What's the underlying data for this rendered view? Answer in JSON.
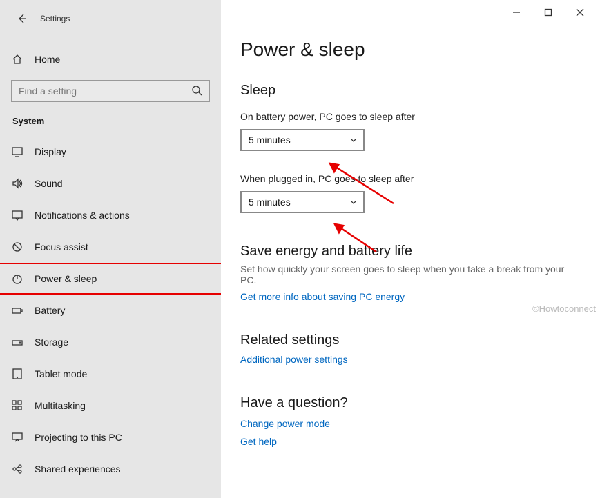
{
  "window": {
    "title": "Settings"
  },
  "sidebar": {
    "home_label": "Home",
    "search_placeholder": "Find a setting",
    "section_label": "System",
    "items": [
      {
        "label": "Display",
        "icon": "display-icon"
      },
      {
        "label": "Sound",
        "icon": "sound-icon"
      },
      {
        "label": "Notifications & actions",
        "icon": "notifications-icon"
      },
      {
        "label": "Focus assist",
        "icon": "focus-icon"
      },
      {
        "label": "Power & sleep",
        "icon": "power-icon",
        "highlighted": true
      },
      {
        "label": "Battery",
        "icon": "battery-icon"
      },
      {
        "label": "Storage",
        "icon": "storage-icon"
      },
      {
        "label": "Tablet mode",
        "icon": "tablet-icon"
      },
      {
        "label": "Multitasking",
        "icon": "multitasking-icon"
      },
      {
        "label": "Projecting to this PC",
        "icon": "projecting-icon"
      },
      {
        "label": "Shared experiences",
        "icon": "shared-icon"
      }
    ]
  },
  "page": {
    "title": "Power & sleep",
    "sleep": {
      "heading": "Sleep",
      "battery_label": "On battery power, PC goes to sleep after",
      "battery_value": "5 minutes",
      "plugged_label": "When plugged in, PC goes to sleep after",
      "plugged_value": "5 minutes"
    },
    "energy": {
      "heading": "Save energy and battery life",
      "hint": "Set how quickly your screen goes to sleep when you take a break from your PC.",
      "link": "Get more info about saving PC energy"
    },
    "related": {
      "heading": "Related settings",
      "link": "Additional power settings"
    },
    "question": {
      "heading": "Have a question?",
      "link1": "Change power mode",
      "link2": "Get help"
    }
  },
  "watermark": "©Howtoconnect"
}
